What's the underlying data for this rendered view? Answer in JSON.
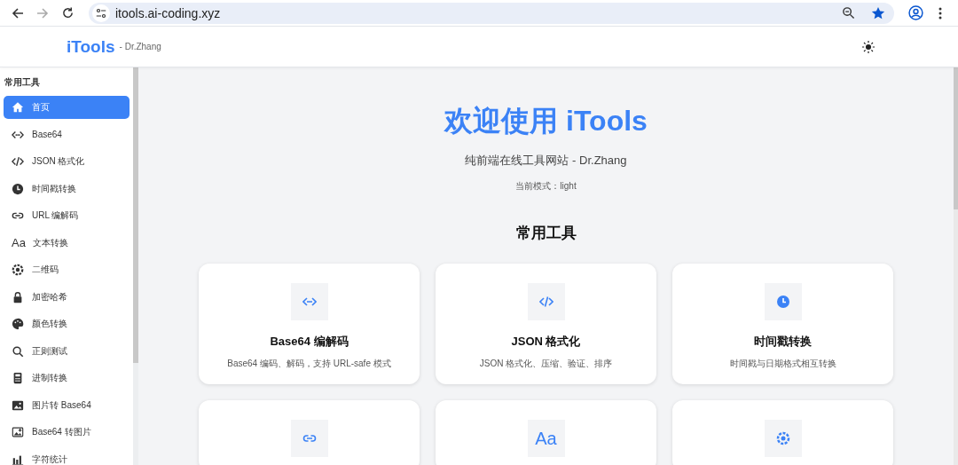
{
  "browser": {
    "url": "itools.ai-coding.xyz",
    "forward_disabled": true,
    "bookmarked": true
  },
  "header": {
    "logo": "iTools",
    "author": "- Dr.Zhang"
  },
  "sidebar": {
    "section": "常用工具",
    "items": [
      {
        "label": "首页",
        "selected": true
      },
      {
        "label": "Base64",
        "selected": false
      },
      {
        "label": "JSON 格式化",
        "selected": false
      },
      {
        "label": "时间戳转换",
        "selected": false
      },
      {
        "label": "URL 编解码",
        "selected": false
      },
      {
        "label": "文本转换",
        "selected": false,
        "glyph": "Aa"
      },
      {
        "label": "二维码",
        "selected": false
      },
      {
        "label": "加密哈希",
        "selected": false
      },
      {
        "label": "颜色转换",
        "selected": false
      },
      {
        "label": "正则测试",
        "selected": false
      },
      {
        "label": "进制转换",
        "selected": false
      },
      {
        "label": "图片转 Base64",
        "selected": false
      },
      {
        "label": "Base64 转图片",
        "selected": false
      },
      {
        "label": "字符统计",
        "selected": false
      }
    ]
  },
  "main": {
    "title": "欢迎使用 iTools",
    "subtitle": "纯前端在线工具网站 - Dr.Zhang",
    "mode": "当前模式：light",
    "section": "常用工具",
    "cards": [
      {
        "kind": "full",
        "title": "Base64 编解码",
        "description": "Base64 编码、解码，支持 URL-safe 模式"
      },
      {
        "kind": "full",
        "title": "JSON 格式化",
        "description": "JSON 格式化、压缩、验证、排序"
      },
      {
        "kind": "full",
        "title": "时间戳转换",
        "description": "时间戳与日期格式相互转换"
      },
      {
        "kind": "cut"
      },
      {
        "kind": "cut",
        "glyph": "Aa"
      },
      {
        "kind": "cut"
      }
    ]
  }
}
